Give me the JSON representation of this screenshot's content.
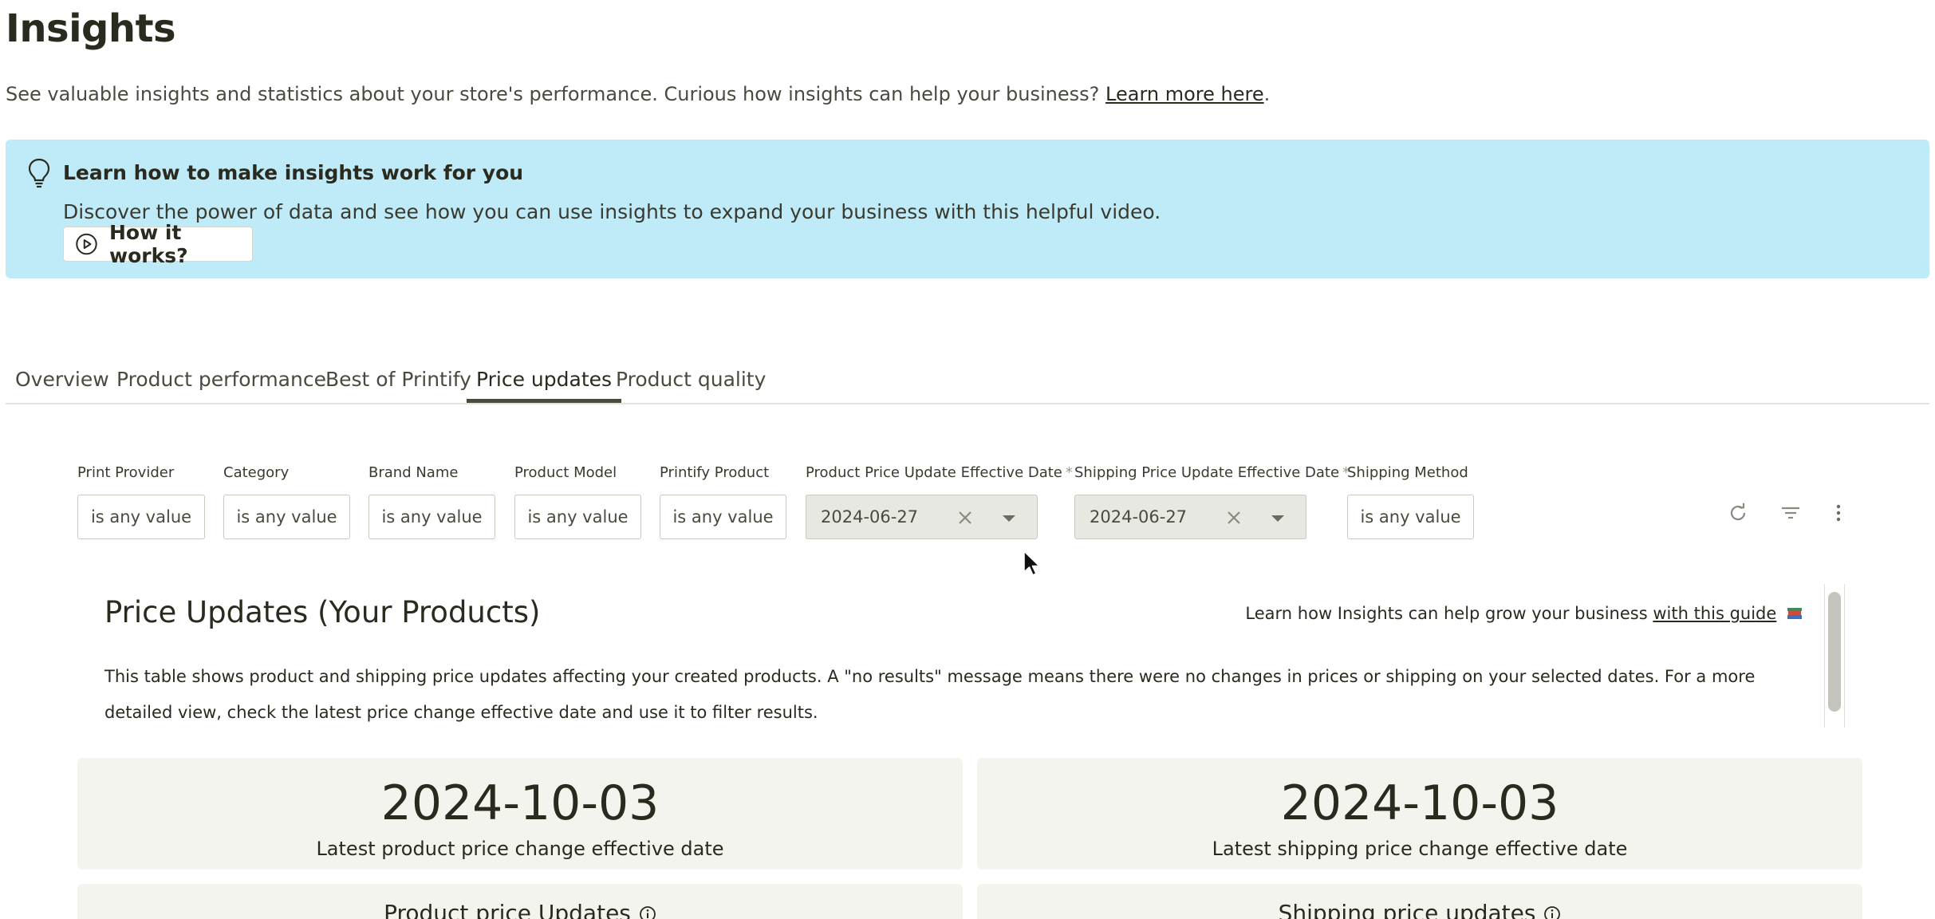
{
  "page": {
    "title": "Insights",
    "subtitle": "See valuable insights and statistics about your store's performance. Curious how insights can help your business?",
    "subtitle_link": "Learn more here",
    "subtitle_end": "."
  },
  "banner": {
    "bg_color": "#bfeaf7",
    "icon": "lightbulb-icon",
    "title": "Learn how to make insights work for you",
    "description": "Discover the power of data and see how you can use insights to expand your business with this helpful video.",
    "button_label": "How it works?",
    "button_icon": "play-circle-icon"
  },
  "tabs": [
    {
      "label": "Overview",
      "active": false
    },
    {
      "label": "Product performance",
      "active": false
    },
    {
      "label": "Best of Printify",
      "active": false
    },
    {
      "label": "Price updates",
      "active": true
    },
    {
      "label": "Product quality",
      "active": false
    }
  ],
  "filters": [
    {
      "label": "Print Provider",
      "value": "is any value"
    },
    {
      "label": "Category",
      "value": "is any value"
    },
    {
      "label": "Brand Name",
      "value": "is any value"
    },
    {
      "label": "Product Model",
      "value": "is any value"
    },
    {
      "label": "Printify Product",
      "value": "is any value"
    },
    {
      "label": "Product Price Update Effective Date",
      "required": "*",
      "value": "2024-06-27"
    },
    {
      "label": "Shipping Price Update Effective Date",
      "required": "*",
      "value": "2024-06-27"
    },
    {
      "label": "Shipping Method",
      "value": "is any value"
    }
  ],
  "toolbar": {
    "refresh_icon": "refresh-icon",
    "filter_icon": "filter-icon",
    "more_icon": "more-vertical-icon"
  },
  "panel": {
    "title": "Price Updates (Your Products)",
    "guide_text": "Learn how Insights can help grow your business",
    "guide_link": "with this guide",
    "description": "This table shows product and shipping price updates affecting your created products. A \"no results\" message means there were no changes in prices or shipping on your selected dates. For a more detailed view, check the latest price change effective date and use it to filter results."
  },
  "cards": {
    "product_date_value": "2024-10-03",
    "product_date_caption": "Latest product price change effective date",
    "shipping_date_value": "2024-10-03",
    "shipping_date_caption": "Latest shipping price change effective date",
    "product_updates_title": "Product price Updates",
    "shipping_updates_title": "Shipping price updates"
  },
  "colors": {
    "card_bg": "#f4f4ee",
    "text_dark": "#2a2a1f",
    "date_field_bg": "#e8e8e2"
  }
}
